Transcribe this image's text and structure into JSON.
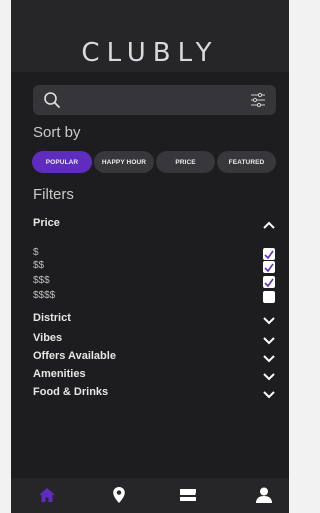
{
  "app": {
    "title": "CLUBLY"
  },
  "search": {
    "placeholder": ""
  },
  "sort": {
    "label": "Sort by",
    "options": [
      "POPULAR",
      "HAPPY HOUR",
      "PRICE",
      "FEATURED"
    ],
    "selected": "POPULAR"
  },
  "filters": {
    "label": "Filters",
    "price": {
      "label": "Price",
      "options": [
        {
          "label": "$",
          "checked": true
        },
        {
          "label": "$$",
          "checked": true
        },
        {
          "label": "$$$",
          "checked": true
        },
        {
          "label": "$$$$",
          "checked": false
        }
      ]
    },
    "sections": [
      "District",
      "Vibes",
      "Offers Available",
      "Amenities",
      "Food & Drinks"
    ]
  },
  "colors": {
    "accent": "#5e2dbf",
    "background": "#1d1d1f",
    "bar": "#262628"
  },
  "nav": {
    "items": [
      {
        "icon": "home-icon",
        "active": true
      },
      {
        "icon": "map-pin-icon",
        "active": false
      },
      {
        "icon": "ticket-icon",
        "active": false
      },
      {
        "icon": "user-icon",
        "active": false
      }
    ]
  }
}
